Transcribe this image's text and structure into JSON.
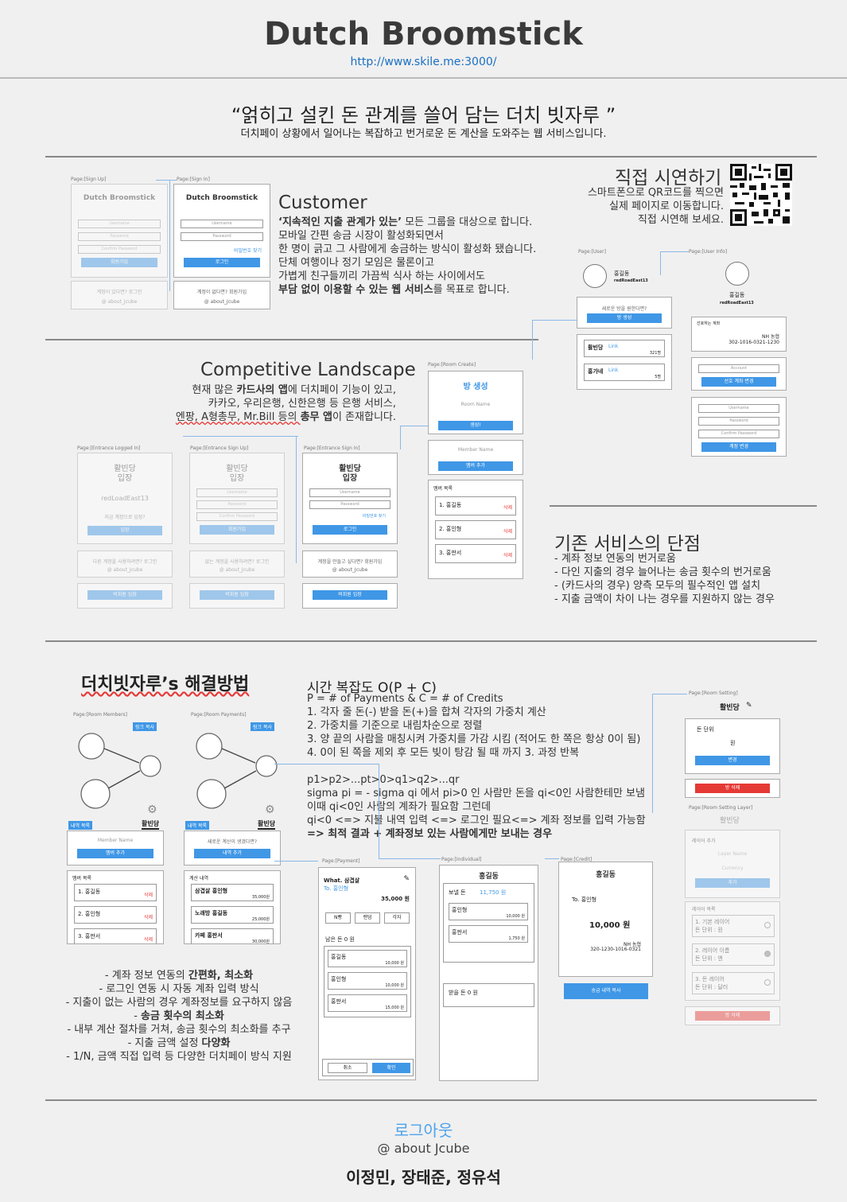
{
  "header": {
    "title": "Dutch Broomstick",
    "url": "http://www.skile.me:3000/"
  },
  "slogan": {
    "main": "“얽히고 설킨 돈 관계를 쓸어 담는 더치 빗자루 ”",
    "sub": "더치페이 상황에서 일어나는 복잡하고 번거로운 돈 계산을 도와주는 웹 서비스입니다."
  },
  "demo": {
    "title": "직접 시연하기",
    "lines": [
      "스마트폰으로 QR코드를 찍으면",
      "실제 페이지로 이동합니다.",
      "직접 시연해 보세요."
    ]
  },
  "customer": {
    "title": "Customer",
    "l1a": "‘지속적인 지출 관계가 있는’",
    "l1b": " 모든 그룹을 대상으로 합니다.",
    "l2": "모바일 간편 송금 시장이 활성화되면서",
    "l3": "한 명이 긁고 그 사람에게 송금하는 방식이 활성화 됐습니다.",
    "l4": "단체 여행이나 정기 모임은 물론이고",
    "l5": "가볍게 친구들끼리 가끔씩 식사 하는 사이에서도",
    "l6a": "부담 없이 이용할 수 있는 웹 서비스",
    "l6b": "를 목표로 합니다."
  },
  "competitive": {
    "title": "Competitive Landscape",
    "l1a": "현재 많은 ",
    "l1b": "카드사의 앱",
    "l1c": "에 더치페이 기능이 있고,",
    "l2": "카카오, 우리은행, 신한은행 등 은행 서비스,",
    "l3a": "엔팡, A형총무, Mr.Bill 등의 ",
    "l3b": "총무 앱",
    "l3c": "이 존재합니다."
  },
  "drawbacks": {
    "title": "기존 서비스의 단점",
    "items": [
      "-  계좌 정보 연동의 번거로움",
      "-  다인 지출의 경우 늘어나는 송금 횟수의 번거로움",
      "-  (카드사의 경우) 양측 모두의 필수적인 앱 설치",
      "-  지출 금액이 차이 나는 경우를 지원하지 않는 경우"
    ]
  },
  "solution": {
    "title": "더치빗자루’s 해결방법",
    "items": [
      {
        "text": "-  계좌 정보 연동의 ",
        "bold": "간편화, 최소화"
      },
      {
        "text": "-  로그인 연동 시 자동 계좌 입력 방식",
        "bold": ""
      },
      {
        "text": "- 지출이 없는 사람의 경우 계좌정보를 요구하지 않음",
        "bold": ""
      },
      {
        "text": "- ",
        "bold": "송금 횟수의 최소화"
      },
      {
        "text": "- 내부 계산 절차를 거쳐, 송금 횟수의 최소화를 추구",
        "bold": ""
      },
      {
        "text": "- 지출 금액 설정 ",
        "bold": "다양화"
      },
      {
        "text": "- 1/N, 금액 직접 입력 등 다양한 더치페이 방식 지원",
        "bold": ""
      }
    ]
  },
  "algorithm": {
    "title": "시간 복잡도 O(P + C)",
    "lines": [
      "P = # of Payments & C = # of Credits",
      "1. 각자 줄 돈(-) 받을 돈(+)을 합쳐 각자의 가중치 계산",
      "2. 가중치를 기준으로 내림차순으로 정렬",
      "3. 양 끝의 사람을 매칭시켜 가중치를 가감 시킴 (적어도 한 쪽은 항상 0이 됨)",
      "4. 0이 된 쪽을 제외 후 모든 빚이 탕감 될 때 까지 3. 과정 반복",
      "",
      "p1>p2>...pt>0>q1>q2>...qr",
      "sigma pi = - sigma qi 에서 pi>0 인 사람만 돈을 qi<0인 사람한테만 보냄",
      "이때 qi<0인 사람의 계좌가 필요함 그런데",
      "qi<0 <=> 지불 내역 입력 <=> 로그인 필요<=> 계좌 정보를 입력 가능함"
    ],
    "result": "=> 최적 결과 + 계좌정보 있는 사람에게만 보내는 경우"
  },
  "wires": {
    "signup_label": "Page:[Sign Up]",
    "signin_label": "Page:[Sign In]",
    "app_name": "Dutch Broomstick",
    "username": "Username",
    "password": "Password",
    "confirm": "Confirm Password",
    "signup_btn": "회원가입",
    "login_btn": "로그인",
    "find_pw": "비밀번호 찾기",
    "have_account": "계정이 있다면? 로그인",
    "no_account": "계정이 없다면? 회원가입",
    "about": "@ about_Jcube",
    "user_label": "Page:[User]",
    "userinfo_label": "Page:[User Info]",
    "user_name": "홍길동",
    "user_id": "redRoadEast13",
    "new_room": "새로운 방을 원한다면?",
    "create_room": "방 생성",
    "room1": "활빈당",
    "room1_cnt": "321명",
    "room2": "홍가네",
    "room2_cnt": "5명",
    "link": "Link",
    "account_title": "선호하는 계좌",
    "bank": "NH 농협",
    "account_no": "302-1016-0321-1230",
    "account_field": "Account",
    "change_account": "선호 계좌 변경",
    "change_info": "계정 변경",
    "room_create_label": "Page:[Room Create]",
    "room_create_title": "방 생성",
    "room_name": "Room Name",
    "create": "생성!",
    "member_name": "Member Name",
    "add_member": "멤버 추가",
    "member_list": "멤버 목록",
    "m1": "1. 홍길동",
    "m2": "2. 홍인형",
    "m3": "3. 홍판서",
    "del": "삭제",
    "entrance_logged": "Page:[Entrance Logged In]",
    "entrance_signup": "Page:[Entrance Sign Up]",
    "entrance_signin": "Page:[Entrance Sign In]",
    "room_title": "활빈당",
    "enter": "입장",
    "current_id": "redLoadEast13",
    "enter_current": "지금 계정으로 입장?",
    "enter_btn": "입장",
    "other_acc": "다른 계정을 사용하려면? 로그인",
    "no_acc": "없는 계정을 사용하려면? 로그인",
    "make_acc": "계정을 만들고 싶다면? 회원가입",
    "guest": "비회원 입장",
    "room_members_label": "Page:[Room Members]",
    "room_payments_label": "Page:[Room Payments]",
    "copy_link": "링크 복사",
    "history": "내역 목록",
    "calc_new": "새로운 계산이 생겼다면?",
    "add_history": "내역 추가",
    "calc_list": "계산 내역",
    "p1": "삼겹살 홍인형",
    "p1_amt": "35,000원",
    "p2": "노래방 홍길동",
    "p2_amt": "25,000원",
    "p3": "카페 홍판서",
    "p3_amt": "30,000원",
    "payment_label": "Page:[Payment]",
    "individual_label": "Page:[Individual]",
    "credit_label": "Page:[Credit]",
    "what": "What. 삼겹살",
    "to": "To. 홍인형",
    "amount": "35,000 원",
    "nbbang": "N빵",
    "fixed": "랜덤",
    "each": "각자",
    "remain": "남은 돈  0 원",
    "r1": "홍길동",
    "r1_amt": "10,000 원",
    "r2": "홍인형",
    "r2_amt": "10,000 원",
    "r3": "홍판서",
    "r3_amt": "15,000 원",
    "cancel": "취소",
    "ok": "확인",
    "send": "보낼 돈",
    "send_amt": "11,750 원",
    "send1": "홍인형",
    "send1_amt": "10,000 원",
    "send2": "홍판서",
    "send2_amt": "1,750 원",
    "receive": "받을 돈  0 원",
    "credit_to": "To. 홍인형",
    "credit_amt": "10,000 원",
    "credit_bank": "NH 농협",
    "credit_no": "320-1230-1016-0321",
    "copy_send": "송금 내역 복사",
    "room_setting_label": "Page:[Room Setting]",
    "room_setting_layer": "Page:[Room Setting Layer]",
    "unit": "돈 단위",
    "won": "원",
    "change": "변경",
    "room_delete": "방 삭제",
    "add_layer": "레이어 추가",
    "layer_name": "Layer Name",
    "currency": "Currency",
    "add": "추가",
    "layer_list": "레이어 목록",
    "layer1": "1. 기본 레이어",
    "layer1u": "돈 단위 : 원",
    "layer2": "2. 레이어 이름",
    "layer2u": "돈 단위 : 엔",
    "layer3": "3. 돈 레이어",
    "layer3u": "돈 단위 : 달러"
  },
  "footer": {
    "logout": "로그아웃",
    "about": "@ about Jcube",
    "names": "이정민, 장태준, 정유석"
  }
}
